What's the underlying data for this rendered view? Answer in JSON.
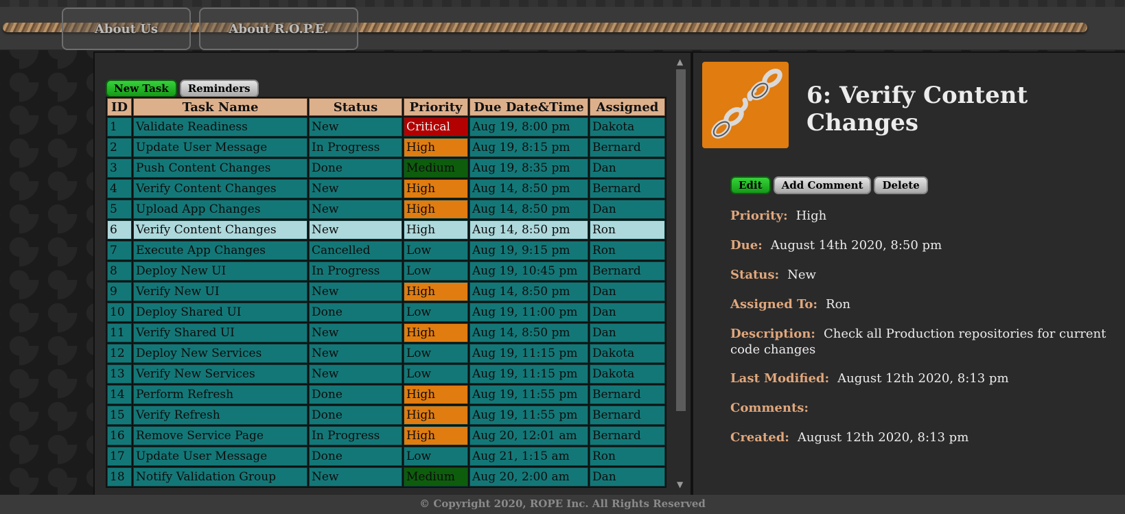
{
  "nav": {
    "about_us": "About Us",
    "about_rope": "About R.O.P.E."
  },
  "toolbar": {
    "new_task": "New Task",
    "reminders": "Reminders"
  },
  "table": {
    "columns": [
      "ID",
      "Task Name",
      "Status",
      "Priority",
      "Due Date&Time",
      "Assigned"
    ],
    "rows": [
      {
        "id": "1",
        "name": "Validate Readiness",
        "status": "New",
        "priority": "Critical",
        "due": "Aug 19, 8:00 pm",
        "assigned": "Dakota"
      },
      {
        "id": "2",
        "name": "Update User Message",
        "status": "In Progress",
        "priority": "High",
        "due": "Aug 19, 8:15 pm",
        "assigned": "Bernard"
      },
      {
        "id": "3",
        "name": "Push Content Changes",
        "status": "Done",
        "priority": "Medium",
        "due": "Aug 19, 8:35 pm",
        "assigned": "Dan"
      },
      {
        "id": "4",
        "name": "Verify Content Changes",
        "status": "New",
        "priority": "High",
        "due": "Aug 14, 8:50 pm",
        "assigned": "Bernard"
      },
      {
        "id": "5",
        "name": "Upload App Changes",
        "status": "New",
        "priority": "High",
        "due": "Aug 14, 8:50 pm",
        "assigned": "Dan"
      },
      {
        "id": "6",
        "name": "Verify Content Changes",
        "status": "New",
        "priority": "High",
        "due": "Aug 14, 8:50 pm",
        "assigned": "Ron",
        "selected": true
      },
      {
        "id": "7",
        "name": "Execute App Changes",
        "status": "Cancelled",
        "priority": "Low",
        "due": "Aug 19, 9:15 pm",
        "assigned": "Ron"
      },
      {
        "id": "8",
        "name": "Deploy New UI",
        "status": "In Progress",
        "priority": "Low",
        "due": "Aug 19, 10:45 pm",
        "assigned": "Bernard"
      },
      {
        "id": "9",
        "name": "Verify New UI",
        "status": "New",
        "priority": "High",
        "due": "Aug 14, 8:50 pm",
        "assigned": "Dan"
      },
      {
        "id": "10",
        "name": "Deploy Shared UI",
        "status": "Done",
        "priority": "Low",
        "due": "Aug 19, 11:00 pm",
        "assigned": "Dan"
      },
      {
        "id": "11",
        "name": "Verify Shared UI",
        "status": "New",
        "priority": "High",
        "due": "Aug 14, 8:50 pm",
        "assigned": "Dan"
      },
      {
        "id": "12",
        "name": "Deploy New Services",
        "status": "New",
        "priority": "Low",
        "due": "Aug 19, 11:15 pm",
        "assigned": "Dakota"
      },
      {
        "id": "13",
        "name": "Verify New Services",
        "status": "New",
        "priority": "Low",
        "due": "Aug 19, 11:15 pm",
        "assigned": "Dakota"
      },
      {
        "id": "14",
        "name": "Perform Refresh",
        "status": "Done",
        "priority": "High",
        "due": "Aug 19, 11:55 pm",
        "assigned": "Bernard"
      },
      {
        "id": "15",
        "name": "Verify Refresh",
        "status": "Done",
        "priority": "High",
        "due": "Aug 19, 11:55 pm",
        "assigned": "Bernard"
      },
      {
        "id": "16",
        "name": "Remove Service Page",
        "status": "In Progress",
        "priority": "High",
        "due": "Aug 20, 12:01 am",
        "assigned": "Bernard"
      },
      {
        "id": "17",
        "name": "Update User Message",
        "status": "Done",
        "priority": "Low",
        "due": "Aug 21, 1:15 am",
        "assigned": "Ron"
      },
      {
        "id": "18",
        "name": "Notify Validation Group",
        "status": "New",
        "priority": "Medium",
        "due": "Aug 20, 2:00 am",
        "assigned": "Dan"
      }
    ]
  },
  "priority_colors": {
    "Critical": "#b30000",
    "High": "#e07c10",
    "Medium": "#0d5d0d",
    "Low": "#147777"
  },
  "detail": {
    "avatar_icon": "broken-chain-icon",
    "title": "6: Verify Content Changes",
    "actions": {
      "edit": "Edit",
      "add_comment": "Add Comment",
      "delete": "Delete"
    },
    "fields": {
      "priority": {
        "label": "Priority:",
        "value": "High"
      },
      "due": {
        "label": "Due:",
        "value": "August 14th 2020, 8:50 pm"
      },
      "status": {
        "label": "Status:",
        "value": "New"
      },
      "assigned": {
        "label": "Assigned To:",
        "value": "Ron"
      },
      "description": {
        "label": "Description:",
        "value": "Check all Production repositories for current code changes"
      },
      "last_modified": {
        "label": "Last Modified:",
        "value": "August 12th 2020, 8:13 pm"
      },
      "comments": {
        "label": "Comments:",
        "value": ""
      },
      "created": {
        "label": "Created:",
        "value": "August 12th 2020, 8:13 pm"
      }
    }
  },
  "footer": {
    "text": "© Copyright 2020, ROPE Inc. All Rights Reserved"
  }
}
